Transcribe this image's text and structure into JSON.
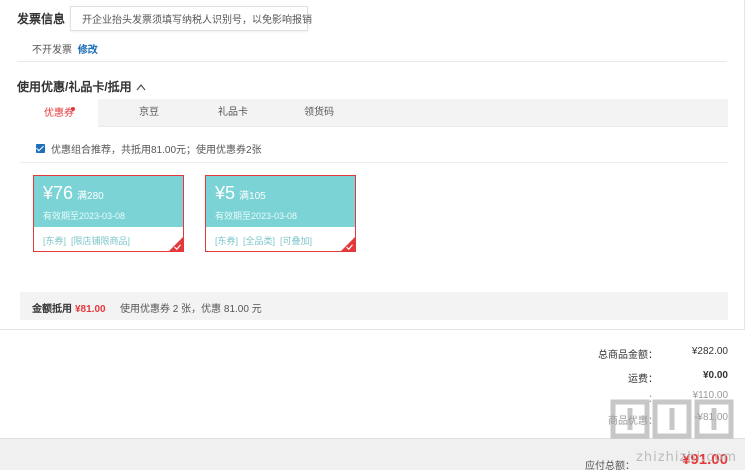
{
  "invoice": {
    "label": "发票信息",
    "tip": "开企业抬头发票须填写纳税人识别号，以免影响报销",
    "status": "不开发票",
    "edit": "修改"
  },
  "discount": {
    "title": "使用优惠/礼品卡/抵用",
    "tabs": [
      {
        "label": "优惠券",
        "active": true
      },
      {
        "label": "京豆",
        "active": false
      },
      {
        "label": "礼品卡",
        "active": false
      },
      {
        "label": "领货码",
        "active": false
      }
    ],
    "recommend_text": "优惠组合推荐，共抵用81.00元；使用优惠券2张",
    "coupons": [
      {
        "amount": "¥76",
        "condition": "满280",
        "valid": "有效期至2023-03-08",
        "tags": [
          "[东券]",
          "[限店铺限商品]"
        ]
      },
      {
        "amount": "¥5",
        "condition": "满105",
        "valid": "有效期至2023-03-08",
        "tags": [
          "[东券]",
          "[全品类]",
          "[可叠加]"
        ]
      }
    ],
    "summary_label": "金额抵用",
    "summary_amount": "¥81.00",
    "summary_used": "使用优惠券 2 张，优惠 81.00 元"
  },
  "totals": {
    "rows": [
      {
        "label": "总商品金额：",
        "value": "¥282.00"
      },
      {
        "label": "运费：",
        "value": "¥0.00"
      },
      {
        "label": "：",
        "value": "¥110.00"
      },
      {
        "label": "商品优惠：",
        "value": "-¥81.00"
      }
    ],
    "pay_label": "应付总额：",
    "pay_value": "¥91.00"
  },
  "watermark": {
    "text": "zhizhizhi.com"
  },
  "colors": {
    "accent": "#e4393c",
    "coupon_teal": "#7bd3d6",
    "link_blue": "#1c6fb8"
  }
}
